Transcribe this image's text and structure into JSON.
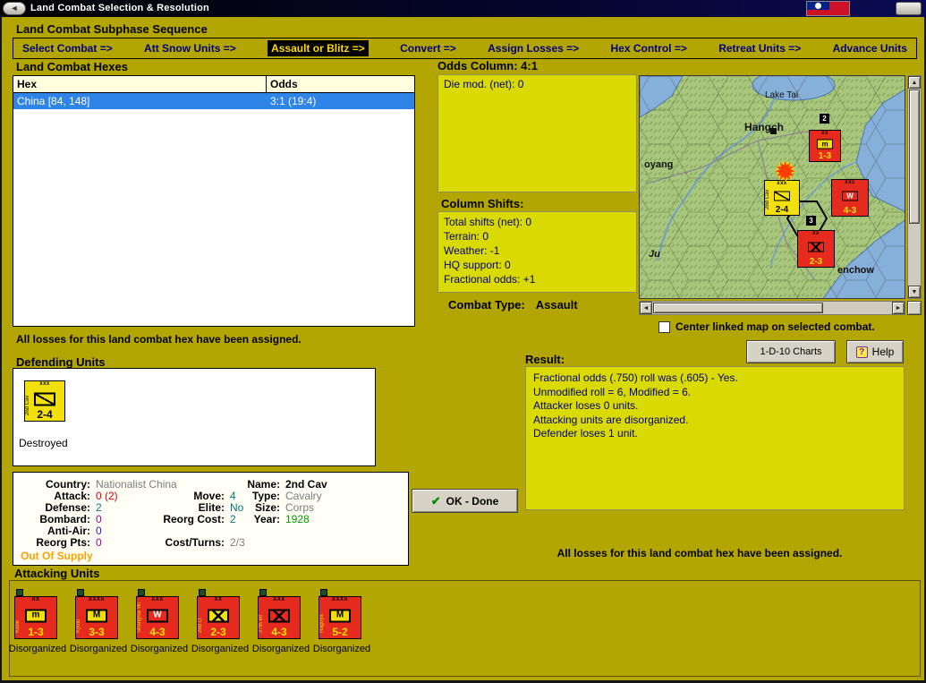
{
  "window": {
    "title": "Land Combat Selection & Resolution"
  },
  "icons": {
    "back": "◄",
    "help": "?",
    "ok_check": "✔",
    "explosion": "✹",
    "up": "▲",
    "down": "▼",
    "left": "◄",
    "right": "►"
  },
  "colors": {
    "background": "#B3A602",
    "panel_yellow": "#DADA00",
    "selection_blue": "#2F84E8",
    "counter_red": "#E62A1E",
    "counter_yellow": "#F2DF0E"
  },
  "sequence": {
    "heading": "Land Combat Subphase Sequence",
    "steps": [
      {
        "label": "Select Combat =>"
      },
      {
        "label": "Att Snow Units =>"
      },
      {
        "label": "Assault or Blitz =>"
      },
      {
        "label": "Convert =>"
      },
      {
        "label": "Assign Losses =>"
      },
      {
        "label": "Hex Control =>"
      },
      {
        "label": "Retreat Units =>"
      },
      {
        "label": "Advance Units"
      }
    ],
    "active_index": 2
  },
  "combat_hexes": {
    "heading": "Land Combat Hexes",
    "columns": {
      "hex": "Hex",
      "odds": "Odds"
    },
    "rows": [
      {
        "hex": "China [84, 148]",
        "odds": "3:1 (19:4)",
        "selected": true
      }
    ]
  },
  "odds_column": {
    "heading": "Odds Column: 4:1",
    "die_mod": "Die mod. (net): 0"
  },
  "column_shifts": {
    "heading": "Column Shifts:",
    "lines": [
      "Total shifts (net): 0",
      "Terrain: 0",
      "Weather: -1",
      "HQ support: 0",
      "Fractional odds: +1"
    ]
  },
  "combat_type": {
    "label": "Combat Type:",
    "value": "Assault"
  },
  "map": {
    "labels": [
      {
        "text": "Lake Tai"
      },
      {
        "text": "Hangch"
      },
      {
        "text": "oyang"
      },
      {
        "text": "Ju"
      },
      {
        "text": "enchow"
      }
    ],
    "markers": [
      {
        "text": "2"
      },
      {
        "text": "3"
      }
    ],
    "units": [
      {
        "size": "xx",
        "symbol": "m",
        "stats": "1-3"
      },
      {
        "size": "xxx",
        "name": "2nd Cav",
        "stats": "2-4"
      },
      {
        "size": "xxx",
        "symbol": "W",
        "stats": "4-3"
      },
      {
        "size": "xx",
        "stats": "2-3"
      }
    ],
    "checkbox_label": "Center linked map on selected combat."
  },
  "buttons": {
    "charts": "1-D-10 Charts",
    "help": "Help",
    "ok": "OK - Done"
  },
  "messages": {
    "losses_left": "All losses for this land combat hex have been assigned.",
    "losses_right": "All losses for this land combat hex have been assigned."
  },
  "defending": {
    "heading": "Defending Units",
    "unit": {
      "size": "xxx",
      "name": "2nd Cav",
      "stats": "2-4",
      "status": "Destroyed"
    }
  },
  "unit_info": {
    "country": {
      "label": "Country:",
      "value": "Nationalist China"
    },
    "attack": {
      "label": "Attack:",
      "value": "0 (2)"
    },
    "defense": {
      "label": "Defense:",
      "value": "2"
    },
    "bombard": {
      "label": "Bombard:",
      "value": "0"
    },
    "anti_air": {
      "label": "Anti-Air:",
      "value": "0"
    },
    "reorg_pts": {
      "label": "Reorg Pts:",
      "value": "0"
    },
    "supply": "Out Of Supply",
    "move": {
      "label": "Move:",
      "value": "4"
    },
    "elite": {
      "label": "Elite:",
      "value": "No"
    },
    "reorg_cost": {
      "label": "Reorg Cost:",
      "value": "2"
    },
    "cost_turns": {
      "label": "Cost/Turns:",
      "value": "2/3"
    },
    "name": {
      "label": "Name:",
      "value": "2nd Cav"
    },
    "type": {
      "label": "Type:",
      "value": "Cavalry"
    },
    "size": {
      "label": "Size:",
      "value": "Corps"
    },
    "year": {
      "label": "Year:",
      "value": "1928"
    }
  },
  "result": {
    "heading": "Result:",
    "lines": [
      "Fractional odds (.750) roll was (.605)  - Yes.",
      "Unmodified roll = 6, Modified = 6.",
      "Attacker loses 0 units.",
      "Attacking units are disorganized.",
      "Defender loses 1 unit."
    ]
  },
  "attacking": {
    "heading": "Attacking Units",
    "units": [
      {
        "size": "XX",
        "name": "Kobe",
        "symbol": "m",
        "stats": "1-3",
        "status": "Disorganized"
      },
      {
        "size": "XXXX",
        "name": "Kyoto",
        "symbol": "M",
        "stats": "3-3",
        "status": "Disorganized"
      },
      {
        "size": "XXX",
        "name": "Shanghai War",
        "symbol": "W",
        "stats": "4-3",
        "status": "Disorganized"
      },
      {
        "size": "XX",
        "name": "2nd Lt",
        "symbol": "X",
        "stats": "2-3",
        "status": "Disorganized"
      },
      {
        "size": "XXX",
        "name": "27th Inf",
        "symbol": "X",
        "stats": "4-3",
        "status": "Disorganized"
      },
      {
        "size": "XXXX",
        "name": "Nagoya",
        "symbol": "M",
        "stats": "5-2",
        "status": "Disorganized"
      }
    ]
  }
}
